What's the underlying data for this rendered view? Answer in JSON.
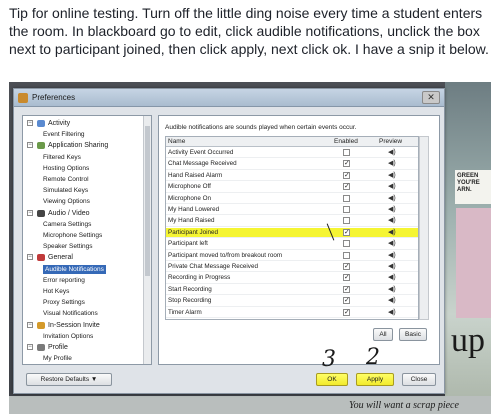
{
  "post": {
    "text": "Tip for online testing. Turn off the little ding noise every time a student enters the room. In blackboard go to edit, click audible notifications, unclick the box next to participant joined, then click apply, next click ok. I have a snip it below."
  },
  "dialog": {
    "title": "Preferences",
    "close_glyph": "✕",
    "tree": [
      {
        "label": "Activity",
        "level": 0,
        "expander": "−",
        "icon_color": "#5a8ad0"
      },
      {
        "label": "Event Filtering",
        "level": 1
      },
      {
        "label": "Application Sharing",
        "level": 0,
        "expander": "−",
        "icon_color": "#6b9a4a"
      },
      {
        "label": "Filtered Keys",
        "level": 1
      },
      {
        "label": "Hosting Options",
        "level": 1
      },
      {
        "label": "Remote Control",
        "level": 1
      },
      {
        "label": "Simulated Keys",
        "level": 1
      },
      {
        "label": "Viewing Options",
        "level": 1
      },
      {
        "label": "Audio / Video",
        "level": 0,
        "expander": "−",
        "icon_color": "#444444"
      },
      {
        "label": "Camera Settings",
        "level": 1
      },
      {
        "label": "Microphone Settings",
        "level": 1
      },
      {
        "label": "Speaker Settings",
        "level": 1
      },
      {
        "label": "General",
        "level": 0,
        "expander": "−",
        "icon_color": "#c03a3a"
      },
      {
        "label": "Audible Notifications",
        "level": 1,
        "selected": true
      },
      {
        "label": "Error reporting",
        "level": 1
      },
      {
        "label": "Hot Keys",
        "level": 1
      },
      {
        "label": "Proxy Settings",
        "level": 1
      },
      {
        "label": "Visual Notifications",
        "level": 1
      },
      {
        "label": "In-Session Invite",
        "level": 0,
        "expander": "−",
        "icon_color": "#d49a2a"
      },
      {
        "label": "Invitation Options",
        "level": 1
      },
      {
        "label": "Profile",
        "level": 0,
        "expander": "−",
        "icon_color": "#7a7a7a"
      },
      {
        "label": "My Profile",
        "level": 1
      }
    ],
    "panel": {
      "description": "Audible notifications are sounds played when certain events occur.",
      "columns": {
        "name": "Name",
        "enabled": "Enabled",
        "preview": "Preview"
      },
      "rows": [
        {
          "name": "Activity Event Occurred",
          "enabled": false,
          "highlight": false
        },
        {
          "name": "Chat Message Received",
          "enabled": true,
          "highlight": false
        },
        {
          "name": "Hand Raised Alarm",
          "enabled": true,
          "highlight": false
        },
        {
          "name": "Microphone Off",
          "enabled": true,
          "highlight": false
        },
        {
          "name": "Microphone On",
          "enabled": false,
          "highlight": false
        },
        {
          "name": "My Hand Lowered",
          "enabled": false,
          "highlight": false
        },
        {
          "name": "My Hand Raised",
          "enabled": false,
          "highlight": false
        },
        {
          "name": "Participant Joined",
          "enabled": true,
          "highlight": true
        },
        {
          "name": "Participant left",
          "enabled": false,
          "highlight": false
        },
        {
          "name": "Participant moved to/from breakout room",
          "enabled": false,
          "highlight": false
        },
        {
          "name": "Private Chat Message Received",
          "enabled": true,
          "highlight": false
        },
        {
          "name": "Recording in Progress",
          "enabled": true,
          "highlight": false
        },
        {
          "name": "Start Recording",
          "enabled": true,
          "highlight": false
        },
        {
          "name": "Stop Recording",
          "enabled": true,
          "highlight": false
        },
        {
          "name": "Timer Alarm",
          "enabled": true,
          "highlight": false
        }
      ],
      "check_glyph": "✓",
      "speaker_glyph": "◀)",
      "all_label": "All",
      "basic_label": "Basic"
    },
    "footer": {
      "restore_label": "Restore Defaults ▼",
      "ok_label": "OK",
      "apply_label": "Apply",
      "close_label": "Close"
    }
  },
  "annotations": {
    "num_ok": "3",
    "num_apply": "2"
  },
  "background": {
    "poster_text": "GREEN YOU'RE ARN.",
    "up_text": "up",
    "bottom_text": "You will want a scrap piece"
  }
}
